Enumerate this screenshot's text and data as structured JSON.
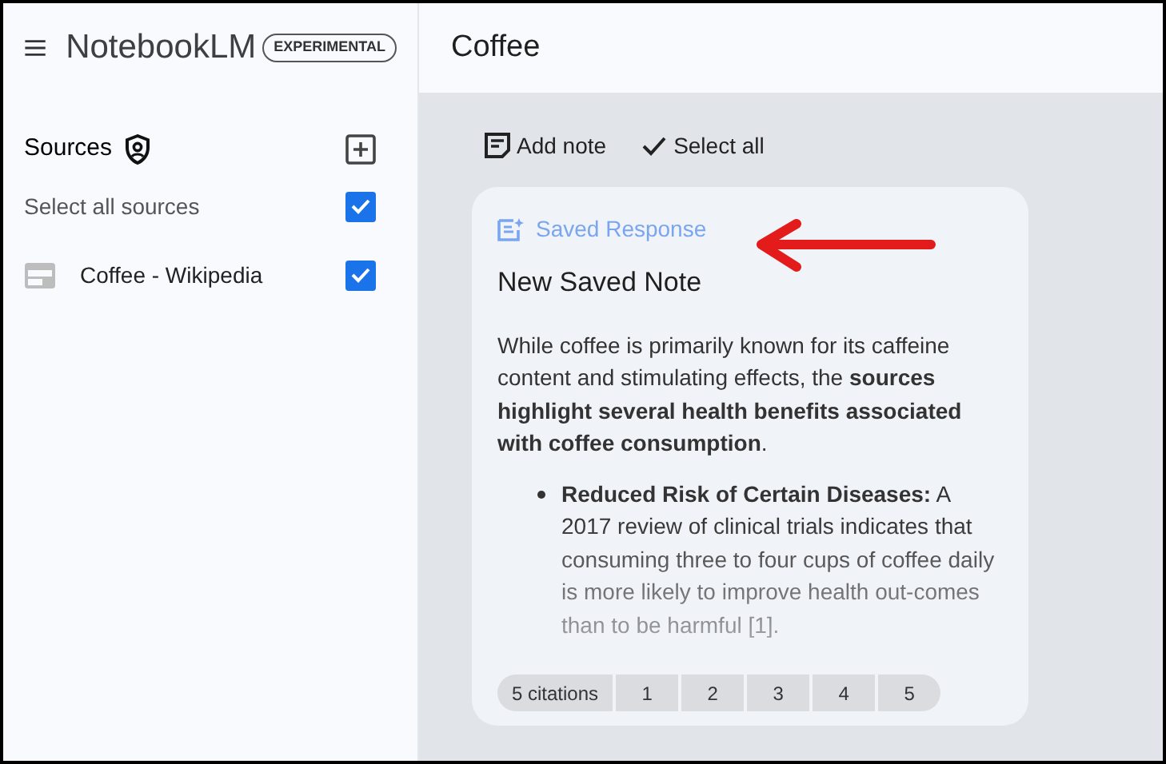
{
  "app": {
    "name": "NotebookLM",
    "badge": "EXPERIMENTAL"
  },
  "sources": {
    "title": "Sources",
    "select_all": {
      "label": "Select all sources",
      "checked": true
    },
    "items": [
      {
        "label": "Coffee - Wikipedia",
        "checked": true
      }
    ]
  },
  "notebook": {
    "title": "Coffee"
  },
  "toolbar": [
    "Add note",
    "Select all"
  ],
  "note": {
    "tag": "Saved Response",
    "title": "New Saved Note",
    "intro": "While coffee is primarily known for its caffeine content and stimulating effects, the **sources highlight several health benefits associated with coffee consumption**.",
    "bullets": [
      "**Reduced Risk of Certain Diseases:** A 2017 review of clinical trials indicates that consuming three to four cups of coffee daily is more likely to improve health out-comes than to be harmful [1]."
    ],
    "citations": {
      "label": "5 citations",
      "numbers": [
        "1",
        "2",
        "3",
        "4",
        "5"
      ]
    }
  }
}
